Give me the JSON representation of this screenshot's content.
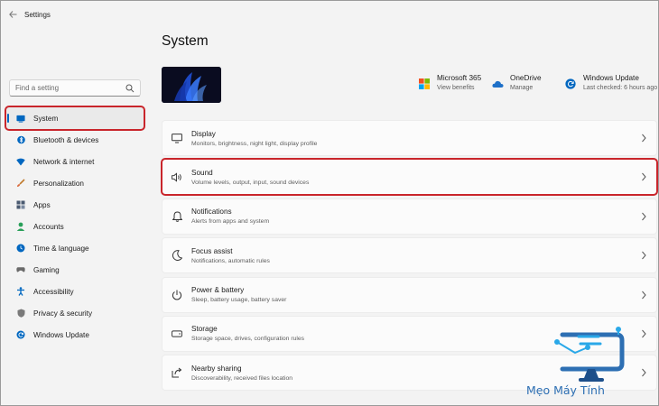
{
  "window": {
    "title": "Settings",
    "back_icon": "back-arrow-icon"
  },
  "sidebar": {
    "search_placeholder": "Find a setting",
    "items": [
      {
        "label": "System",
        "icon": "system-icon",
        "color": "#0067c0",
        "selected": true
      },
      {
        "label": "Bluetooth & devices",
        "icon": "bluetooth-icon",
        "color": "#0067c0"
      },
      {
        "label": "Network & internet",
        "icon": "wifi-icon",
        "color": "#0067c0"
      },
      {
        "label": "Personalization",
        "icon": "brush-icon",
        "color": "#c07a2c"
      },
      {
        "label": "Apps",
        "icon": "apps-icon",
        "color": "#4a5a70"
      },
      {
        "label": "Accounts",
        "icon": "person-icon",
        "color": "#2aa05a"
      },
      {
        "label": "Time & language",
        "icon": "globe-clock-icon",
        "color": "#0067c0"
      },
      {
        "label": "Gaming",
        "icon": "controller-icon",
        "color": "#6a6a6a"
      },
      {
        "label": "Accessibility",
        "icon": "accessibility-icon",
        "color": "#0067c0"
      },
      {
        "label": "Privacy & security",
        "icon": "shield-icon",
        "color": "#6a6a6a"
      },
      {
        "label": "Windows Update",
        "icon": "update-icon",
        "color": "#0067c0"
      }
    ]
  },
  "main": {
    "title": "System",
    "quick": [
      {
        "title": "Microsoft 365",
        "sub": "View benefits",
        "icon": "microsoft-365-icon"
      },
      {
        "title": "OneDrive",
        "sub": "Manage",
        "icon": "onedrive-icon"
      },
      {
        "title": "Windows Update",
        "sub": "Last checked: 6 hours ago",
        "icon": "windows-update-icon"
      }
    ],
    "cards": [
      {
        "title": "Display",
        "sub": "Monitors, brightness, night light, display profile",
        "icon": "display-icon"
      },
      {
        "title": "Sound",
        "sub": "Volume levels, output, input, sound devices",
        "icon": "speaker-icon",
        "highlight": true
      },
      {
        "title": "Notifications",
        "sub": "Alerts from apps and system",
        "icon": "bell-icon"
      },
      {
        "title": "Focus assist",
        "sub": "Notifications, automatic rules",
        "icon": "moon-icon"
      },
      {
        "title": "Power & battery",
        "sub": "Sleep, battery usage, battery saver",
        "icon": "power-icon"
      },
      {
        "title": "Storage",
        "sub": "Storage space, drives, configuration rules",
        "icon": "storage-icon"
      },
      {
        "title": "Nearby sharing",
        "sub": "Discoverability, received files location",
        "icon": "share-icon"
      }
    ]
  },
  "watermark": {
    "text": "Mẹo Máy Tính",
    "color": "#2d6fb3"
  },
  "colors": {
    "accent": "#0067c0",
    "highlight_box": "#c9252b"
  }
}
